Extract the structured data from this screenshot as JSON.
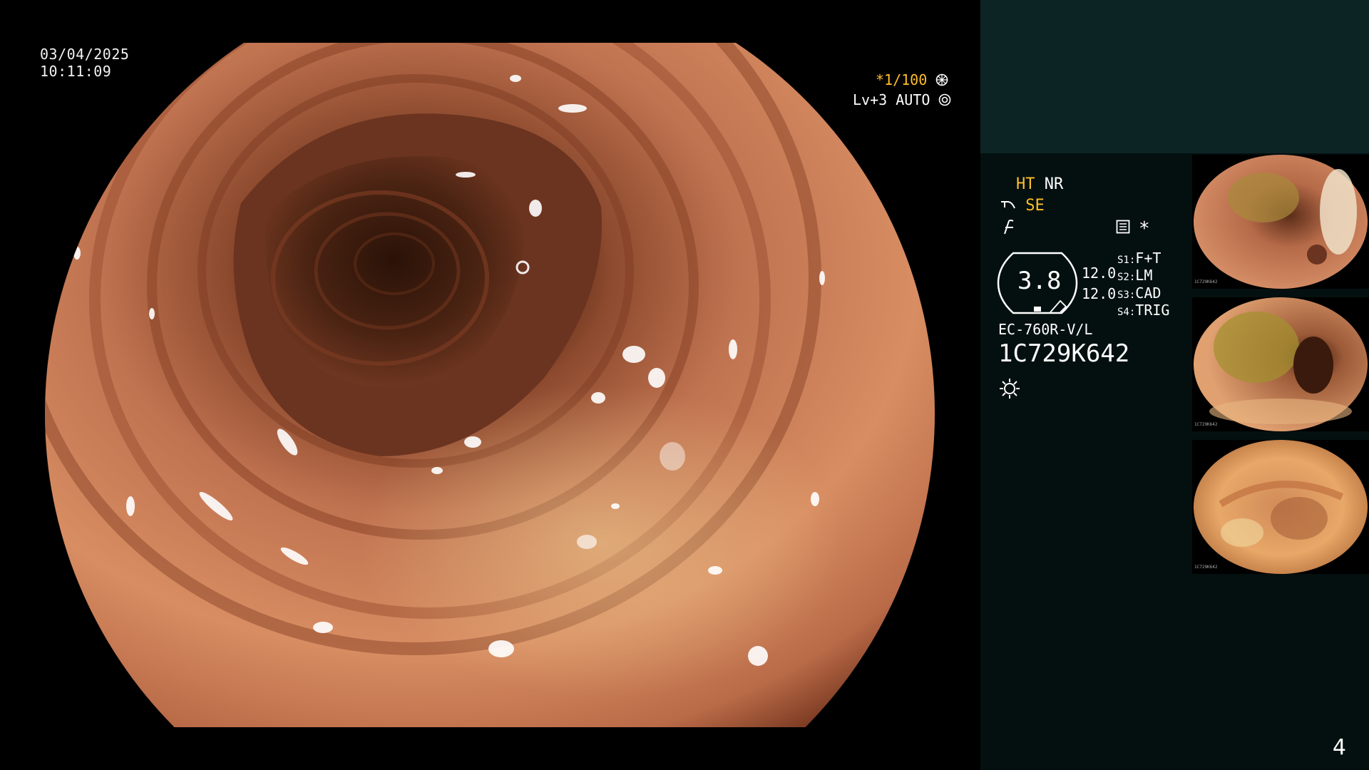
{
  "display": {
    "date": "03/04/2025",
    "time": "10:11:09",
    "shutter": "*1/100",
    "light_level": "Lv+3 AUTO"
  },
  "panel": {
    "ht_label": "HT",
    "nr_label": "NR",
    "se_label": "SE",
    "value_main": "3.8",
    "value_a": "12.0",
    "value_b": "12.0",
    "s1_key": "S1:",
    "s1_val": "F+T",
    "s2_key": "S2:",
    "s2_val": "LM",
    "s3_key": "S3:",
    "s3_val": "CAD",
    "s4_key": "S4:",
    "s4_val": "TRIG",
    "scope_model": "EC-760R-V/L",
    "scope_serial": "1C729K642",
    "page_number": "4"
  },
  "thumbnails": [
    {
      "id_label": "1C729K642",
      "index": "3"
    },
    {
      "id_label": "1C729K642",
      "index": "2"
    },
    {
      "id_label": "1C729K642",
      "index": "1"
    }
  ],
  "colors": {
    "accent_yellow": "#ffbe2c",
    "panel_top": "#0d2425",
    "panel_bg": "#03100f",
    "mucosa": "#c77a55"
  },
  "icons": [
    "structure-enhance-icon",
    "color-enhance-icon",
    "record-icon",
    "asterisk-icon",
    "light-source-icon",
    "shutter-icon",
    "auto-light-icon"
  ]
}
